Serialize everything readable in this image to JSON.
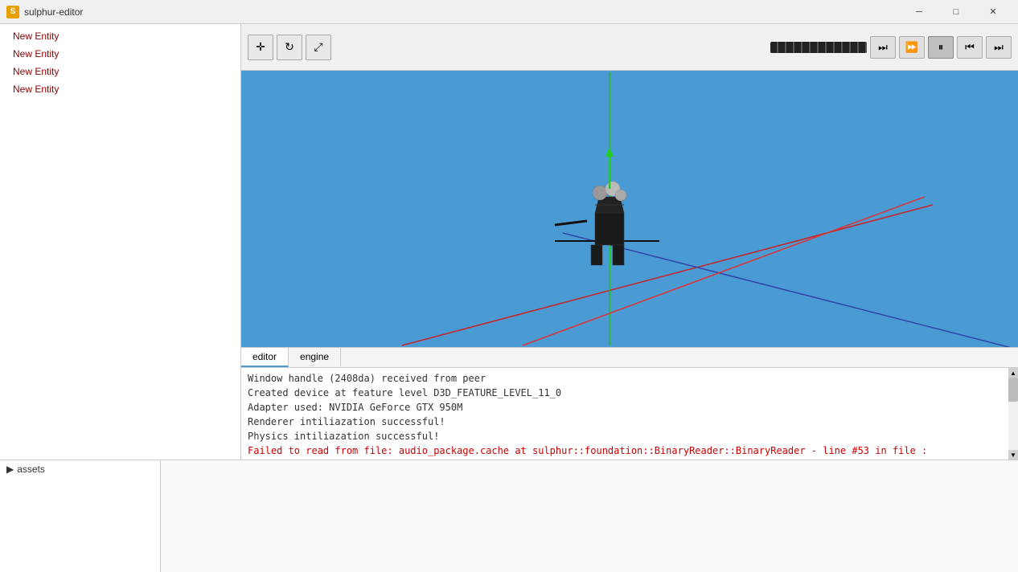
{
  "titleBar": {
    "icon": "S",
    "title": "sulphur-editor",
    "minimize": "─",
    "maximize": "□",
    "close": "✕"
  },
  "entityList": {
    "items": [
      "New Entity",
      "New Entity",
      "New Entity",
      "New Entity"
    ]
  },
  "toolbar": {
    "moveTool": "+",
    "refreshBtn": "↺",
    "expandBtn": "⛶"
  },
  "transport": {
    "skipForward": "⏭",
    "stepForward": "⏩",
    "pause": "⏸",
    "stepBack": "⏮",
    "skipBack": "⏮"
  },
  "consoleTabs": [
    {
      "id": "editor",
      "label": "editor",
      "active": true
    },
    {
      "id": "engine",
      "label": "engine",
      "active": false
    }
  ],
  "consoleLines": [
    {
      "text": "Window handle (2408da) received from peer",
      "type": "normal"
    },
    {
      "text": "Created device at feature level D3D_FEATURE_LEVEL_11_0",
      "type": "normal"
    },
    {
      "text": "Adapter used: NVIDIA GeForce GTX 950M",
      "type": "normal"
    },
    {
      "text": "Renderer intiliazation successful!",
      "type": "normal"
    },
    {
      "text": "Physics intiliazation successful!",
      "type": "normal"
    },
    {
      "text": "Failed to read from file: audio_package.cache at sulphur::foundation::BinaryReader::BinaryReader - line #53 in file :",
      "type": "error"
    }
  ],
  "assetsPanel": {
    "label": "assets"
  }
}
